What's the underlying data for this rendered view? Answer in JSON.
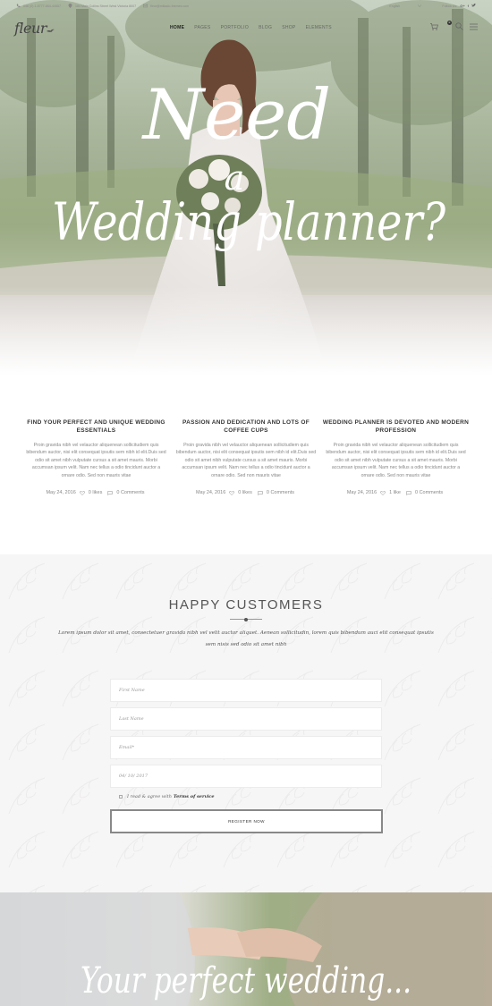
{
  "topbar": {
    "phone": "046 (0) 1-8777-654-44557",
    "address": "184 Main Collins Street West Victoria 8007",
    "email": "fleur@mikado-themes.com",
    "language": "English",
    "follow_label": "Follow Us:"
  },
  "header": {
    "logo": "fleur",
    "nav": [
      "HOME",
      "PAGES",
      "PORTFOLIO",
      "BLOG",
      "SHOP",
      "ELEMENTS"
    ],
    "cart_count": "0"
  },
  "hero": {
    "line1": "Need",
    "line2": "a",
    "line3": "Wedding planner?"
  },
  "posts": [
    {
      "title": "FIND YOUR PERFECT AND UNIQUE WEDDING ESSENTIALS",
      "excerpt": "Proin gravida nibh vel velauctor aliquenean sollicitudiem quis bibendum auctor, nisi elit consequat ipsutis sem nibh id elit.Duis sed odio sit amet nibh vulputate cursus a sit amet mauris. Morbi accumsan ipsum velit. Nam nec tellus a odio tincidunt auctor a ornare odio. Sed non mauris vitae",
      "date": "May 24, 2016",
      "likes": "0 likes",
      "comments": "0 Comments"
    },
    {
      "title": "PASSION AND DEDICATION AND LOTS OF COFFEE CUPS",
      "excerpt": "Proin gravida nibh vel velauctor aliquenean sollicitudiem quis bibendum auctor, nisi elit consequat ipsutis sem nibh id elit.Duis sed odio sit amet nibh vulputate cursus a sit amet mauris. Morbi accumsan ipsum velit. Nam nec tellus a odio tincidunt auctor a ornare odio. Sed non mauris vitae",
      "date": "May 24, 2016",
      "likes": "0 likes",
      "comments": "0 Comments"
    },
    {
      "title": "WEDDING PLANNER IS DEVOTED AND MODERN PROFESSION",
      "excerpt": "Proin gravida nibh vel velauctor aliquenean sollicitudiem quis bibendum auctor, nisi elit consequat ipsutis sem nibh id elit.Duis sed odio sit amet nibh vulputate cursus a sit amet mauris. Morbi accumsan ipsum velit. Nam nec tellus a odio tincidunt auctor a ornare odio. Sed non mauris vitae",
      "date": "May 24, 2016",
      "likes": "1 like",
      "comments": "0 Comments"
    }
  ],
  "customers": {
    "title": "HAPPY CUSTOMERS",
    "description": "Lorem ipsum dolor sit amet, consectetuer gravida nibh vel velit auctor aliquet. Aenean sollicitudin, lorem quis bibendum auci elit consequat ipsutis sem nisis sed odio sit amet nibh",
    "fields": {
      "first_name": "First Name",
      "last_name": "Last Name",
      "email": "Email*",
      "date": "04/ 10/ 2017"
    },
    "terms_text": "I read & agree with",
    "terms_link": "Terms of service",
    "register_label": "REGISTER NOW"
  },
  "banner": {
    "text": "Your perfect wedding..."
  },
  "colors": {
    "accent": "#333333",
    "section_bg": "#f7f6f6"
  }
}
